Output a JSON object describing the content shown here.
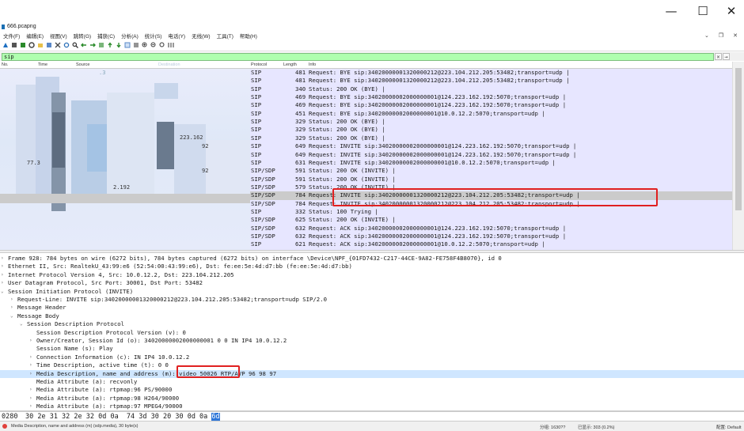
{
  "window": {
    "title": "666.pcapng",
    "minimize": "—",
    "maximize": "☐",
    "close": "✕"
  },
  "menu": {
    "items": [
      "文件(F)",
      "编辑(E)",
      "视图(V)",
      "跳转(G)",
      "捕获(C)",
      "分析(A)",
      "统计(S)",
      "电话(Y)",
      "无线(W)",
      "工具(T)",
      "帮助(H)"
    ],
    "right_controls": [
      "⌄",
      "❐",
      "✕"
    ]
  },
  "toolbar": {
    "icons": [
      "shark-fin-icon",
      "stop-icon",
      "restart-icon",
      "options-icon",
      "open-icon",
      "save-icon",
      "close-file-icon",
      "reload-icon",
      "find-icon",
      "back-icon",
      "forward-icon",
      "goto-icon",
      "first-icon",
      "last-icon",
      "autoscroll-icon",
      "colorize-icon",
      "zoom-in-icon",
      "zoom-out-icon",
      "zoom-reset-icon",
      "resize-columns-icon"
    ]
  },
  "filter": {
    "value": "sip",
    "clear": "✕",
    "apply": "→"
  },
  "columns": {
    "no": "No.",
    "time": "Time",
    "source": "Source",
    "destination": "Destination",
    "protocol": "Protocol",
    "length": "Length",
    "info": "Info"
  },
  "packets": [
    {
      "proto": "SIP",
      "len": "481",
      "info": "Request: BYE sip:34020000001320000212@223.104.212.205:53482;transport=udp  |"
    },
    {
      "proto": "SIP",
      "len": "481",
      "info": "Request: BYE sip:34020000001320000212@223.104.212.205:53482;transport=udp  |"
    },
    {
      "proto": "SIP",
      "len": "340",
      "info": "Status: 200 OK (BYE)  |"
    },
    {
      "proto": "SIP",
      "len": "469",
      "info": "Request: BYE sip:34020000002000000001@124.223.162.192:5070;transport=udp  |"
    },
    {
      "proto": "SIP",
      "len": "469",
      "info": "Request: BYE sip:34020000002000000001@124.223.162.192:5070;transport=udp  |"
    },
    {
      "proto": "SIP",
      "len": "451",
      "info": "Request: BYE sip:34020000002000000001@10.0.12.2:5070;transport=udp  |"
    },
    {
      "proto": "SIP",
      "len": "329",
      "info": "Status: 200 OK (BYE)  |"
    },
    {
      "proto": "SIP",
      "len": "329",
      "info": "Status: 200 OK (BYE)  |"
    },
    {
      "proto": "SIP",
      "len": "329",
      "info": "Status: 200 OK (BYE)  |"
    },
    {
      "proto": "SIP",
      "len": "649",
      "info": "Request: INVITE sip:34020000002000000001@124.223.162.192:5070;transport=udp  |"
    },
    {
      "proto": "SIP",
      "len": "649",
      "info": "Request: INVITE sip:34020000002000000001@124.223.162.192:5070;transport=udp  |"
    },
    {
      "proto": "SIP",
      "len": "631",
      "info": "Request: INVITE sip:34020000002000000001@10.0.12.2:5070;transport=udp  |"
    },
    {
      "proto": "SIP/SDP",
      "len": "591",
      "info": "Status: 200 OK (INVITE)  |"
    },
    {
      "proto": "SIP/SDP",
      "len": "591",
      "info": "Status: 200 OK (INVITE)  |"
    },
    {
      "proto": "SIP/SDP",
      "len": "579",
      "info": "Status: 200 OK (INVITE)  |"
    },
    {
      "proto": "SIP/SDP",
      "len": "784",
      "info": "Request: INVITE sip:34020000001320000212@223.104.212.205:53482;transport=udp  |",
      "selected": true
    },
    {
      "proto": "SIP/SDP",
      "len": "784",
      "info": "Request: INVITE sip:34020000001320000212@223.104.212.205:53482;transport=udp  |"
    },
    {
      "proto": "SIP",
      "len": "332",
      "info": "Status: 100 Trying  |"
    },
    {
      "proto": "SIP/SDP",
      "len": "625",
      "info": "Status: 200 OK (INVITE)  |"
    },
    {
      "proto": "SIP/SDP",
      "len": "632",
      "info": "Request: ACK sip:34020000002000000001@124.223.162.192:5070;transport=udp  |"
    },
    {
      "proto": "SIP/SDP",
      "len": "632",
      "info": "Request: ACK sip:34020000002000000001@124.223.162.192:5070;transport=udp  |"
    },
    {
      "proto": "SIP",
      "len": "621",
      "info": "Request: ACK sip:34020000002000000001@10.0.12.2:5070;transport=udp  |"
    }
  ],
  "list_fragments": [
    "2.192",
    "92",
    "92",
    "2.192",
    "223.162",
    ".3",
    "77.3"
  ],
  "details": [
    {
      "indent": 0,
      "arrow": "›",
      "text": "Frame 928: 784 bytes on wire (6272 bits), 784 bytes captured (6272 bits) on interface \\Device\\NPF_{01FD7432-C217-44CE-9A82-FE758F4B8070}, id 0"
    },
    {
      "indent": 0,
      "arrow": "›",
      "text": "Ethernet II, Src: RealtekU_43:99:e6 (52:54:00:43:99:e6), Dst: fe:ee:5e:4d:d7:bb (fe:ee:5e:4d:d7:bb)"
    },
    {
      "indent": 0,
      "arrow": "›",
      "text": "Internet Protocol Version 4, Src: 10.0.12.2, Dst: 223.104.212.205"
    },
    {
      "indent": 0,
      "arrow": "›",
      "text": "User Datagram Protocol, Src Port: 30001, Dst Port: 53482"
    },
    {
      "indent": 0,
      "arrow": "⌄",
      "text": "Session Initiation Protocol (INVITE)"
    },
    {
      "indent": 1,
      "arrow": "›",
      "text": "Request-Line: INVITE sip:34020000001320000212@223.104.212.205:53482;transport=udp SIP/2.0"
    },
    {
      "indent": 1,
      "arrow": "›",
      "text": "Message Header"
    },
    {
      "indent": 1,
      "arrow": "⌄",
      "text": "Message Body"
    },
    {
      "indent": 2,
      "arrow": "⌄",
      "text": "Session Description Protocol"
    },
    {
      "indent": 3,
      "arrow": "",
      "text": "Session Description Protocol Version (v): 0"
    },
    {
      "indent": 3,
      "arrow": "›",
      "text": "Owner/Creator, Session Id (o): 34020000002000000001 0 0 IN IP4 10.0.12.2"
    },
    {
      "indent": 3,
      "arrow": "",
      "text": "Session Name (s): Play"
    },
    {
      "indent": 3,
      "arrow": "›",
      "text": "Connection Information (c): IN IP4 10.0.12.2"
    },
    {
      "indent": 3,
      "arrow": "›",
      "text": "Time Description, active time (t): 0 0"
    },
    {
      "indent": 3,
      "arrow": "›",
      "text": "Media Description, name and address (m): video 50026 RTP/AVP 96 98 97",
      "selected": true
    },
    {
      "indent": 3,
      "arrow": "",
      "text": "Media Attribute (a): recvonly"
    },
    {
      "indent": 3,
      "arrow": "›",
      "text": "Media Attribute (a): rtpmap:96 PS/90000"
    },
    {
      "indent": 3,
      "arrow": "›",
      "text": "Media Attribute (a): rtpmap:98 H264/90000"
    },
    {
      "indent": 3,
      "arrow": "›",
      "text": "Media Attribute (a): rtpmap:97 MPEG4/90000"
    }
  ],
  "bytes": {
    "offset": "0280",
    "hex": "30 2e 31 32 2e 32 0d 0a  74 3d 30 20 30 0d 0a ",
    "hex_selected": "6d"
  },
  "status": {
    "left": "Media Description, name and address (m) (sdp.media), 30 byte(s)",
    "packets": "分组: 1630??",
    "displayed": "已显示: 303 (0.2%)",
    "profile": "配置: Default"
  },
  "colors": {
    "packet_bg": "#e7e6ff",
    "selected_row": "#cbcbcb",
    "filter_ok": "#afffaf",
    "highlight_box": "#e02020",
    "detail_selected": "#cfe6ff",
    "byte_selected": "#2f77d8"
  }
}
